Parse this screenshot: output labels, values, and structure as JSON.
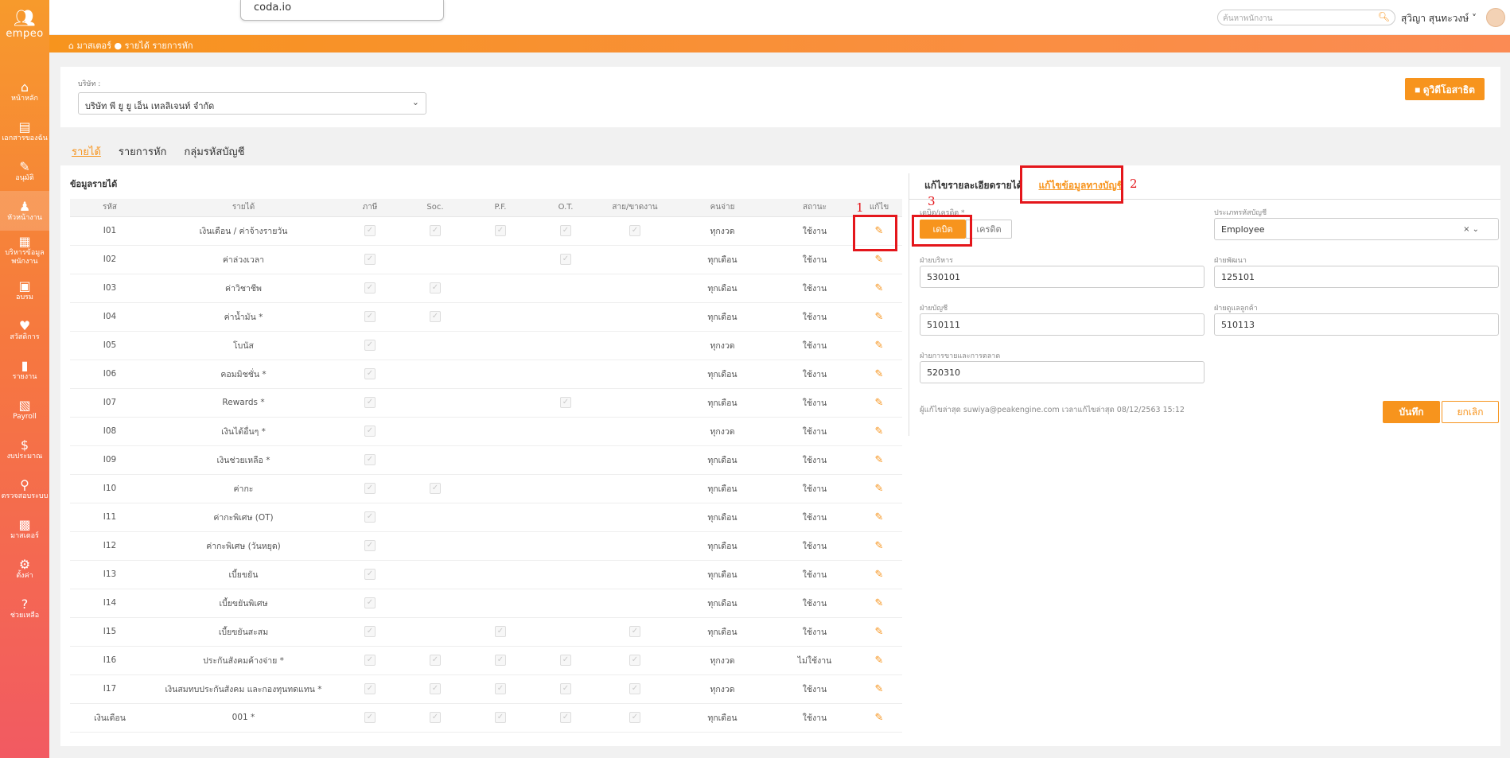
{
  "app": {
    "logo_text": "empeo"
  },
  "sidebar": {
    "items": [
      {
        "label": "หน้าหลัก",
        "icon": "home-icon",
        "glyph": "⌂"
      },
      {
        "label": "เอกสารของฉัน",
        "icon": "document-icon",
        "glyph": "▤"
      },
      {
        "label": "อนุมัติ",
        "icon": "approve-icon",
        "glyph": "✎"
      },
      {
        "label": "หัวหน้างาน",
        "icon": "supervisor-icon",
        "glyph": "♟"
      },
      {
        "label": "บริหารข้อมูลพนักงาน",
        "icon": "employee-icon",
        "glyph": "▦"
      },
      {
        "label": "อบรม",
        "icon": "training-icon",
        "glyph": "▣"
      },
      {
        "label": "สวัสดิการ",
        "icon": "welfare-icon",
        "glyph": "♥"
      },
      {
        "label": "รายงาน",
        "icon": "report-icon",
        "glyph": "▮"
      },
      {
        "label": "Payroll",
        "icon": "payroll-icon",
        "glyph": "▧"
      },
      {
        "label": "งบประมาณ",
        "icon": "budget-icon",
        "glyph": "$"
      },
      {
        "label": "ตรวจสอบระบบ",
        "icon": "audit-icon",
        "glyph": "⚲"
      },
      {
        "label": "มาสเตอร์",
        "icon": "master-icon",
        "glyph": "▩"
      },
      {
        "label": "ตั้งค่า",
        "icon": "settings-icon",
        "glyph": "⚙"
      },
      {
        "label": "ช่วยเหลือ",
        "icon": "help-icon",
        "glyph": "?"
      }
    ]
  },
  "topbar": {
    "popup_text": "coda.io",
    "search_placeholder": "ค้นหาพนักงาน",
    "user_name": "สุวิญา สุนทะวงษ์"
  },
  "breadcrumb": "มาสเตอร์ ● รายได้ รายการหัก",
  "company": {
    "label": "บริษัท :",
    "value": "บริษัท พี ยู ยู เอ็น เทลลิเจนท์ จำกัด",
    "video_button": "ดูวิดีโอสาธิต"
  },
  "tabs": [
    "รายได้",
    "รายการหัก",
    "กลุ่มรหัสบัญชี"
  ],
  "income": {
    "title": "ข้อมูลรายได้",
    "columns": [
      "รหัส",
      "รายได้",
      "ภาษี",
      "Soc.",
      "P.F.",
      "O.T.",
      "สาย/ขาดงาน",
      "คนจ่าย",
      "สถานะ",
      "แก้ไข"
    ],
    "rows": [
      {
        "code": "I01",
        "name": "เงินเดือน / ค่าจ้างรายวัน",
        "tax": true,
        "soc": true,
        "pf": true,
        "ot": true,
        "late": true,
        "pay": "ทุกงวด",
        "status": "ใช้งาน"
      },
      {
        "code": "I02",
        "name": "ค่าล่วงเวลา",
        "tax": true,
        "soc": false,
        "pf": false,
        "ot": true,
        "late": false,
        "pay": "ทุกเดือน",
        "status": "ใช้งาน"
      },
      {
        "code": "I03",
        "name": "ค่าวิชาชีพ",
        "tax": true,
        "soc": true,
        "pf": false,
        "ot": false,
        "late": false,
        "pay": "ทุกเดือน",
        "status": "ใช้งาน"
      },
      {
        "code": "I04",
        "name": "ค่าน้ำมัน *",
        "tax": true,
        "soc": true,
        "pf": false,
        "ot": false,
        "late": false,
        "pay": "ทุกเดือน",
        "status": "ใช้งาน"
      },
      {
        "code": "I05",
        "name": "โบนัส",
        "tax": true,
        "soc": false,
        "pf": false,
        "ot": false,
        "late": false,
        "pay": "ทุกงวด",
        "status": "ใช้งาน"
      },
      {
        "code": "I06",
        "name": "คอมมิชชั่น *",
        "tax": true,
        "soc": false,
        "pf": false,
        "ot": false,
        "late": false,
        "pay": "ทุกเดือน",
        "status": "ใช้งาน"
      },
      {
        "code": "I07",
        "name": "Rewards *",
        "tax": true,
        "soc": false,
        "pf": false,
        "ot": true,
        "late": false,
        "pay": "ทุกเดือน",
        "status": "ใช้งาน"
      },
      {
        "code": "I08",
        "name": "เงินได้อื่นๆ *",
        "tax": true,
        "soc": false,
        "pf": false,
        "ot": false,
        "late": false,
        "pay": "ทุกงวด",
        "status": "ใช้งาน"
      },
      {
        "code": "I09",
        "name": "เงินช่วยเหลือ *",
        "tax": true,
        "soc": false,
        "pf": false,
        "ot": false,
        "late": false,
        "pay": "ทุกเดือน",
        "status": "ใช้งาน"
      },
      {
        "code": "I10",
        "name": "ค่ากะ",
        "tax": true,
        "soc": true,
        "pf": false,
        "ot": false,
        "late": false,
        "pay": "ทุกเดือน",
        "status": "ใช้งาน"
      },
      {
        "code": "I11",
        "name": "ค่ากะพิเศษ (OT)",
        "tax": true,
        "soc": false,
        "pf": false,
        "ot": false,
        "late": false,
        "pay": "ทุกเดือน",
        "status": "ใช้งาน"
      },
      {
        "code": "I12",
        "name": "ค่ากะพิเศษ (วันหยุด)",
        "tax": true,
        "soc": false,
        "pf": false,
        "ot": false,
        "late": false,
        "pay": "ทุกเดือน",
        "status": "ใช้งาน"
      },
      {
        "code": "I13",
        "name": "เบี้ยขยัน",
        "tax": true,
        "soc": false,
        "pf": false,
        "ot": false,
        "late": false,
        "pay": "ทุกเดือน",
        "status": "ใช้งาน"
      },
      {
        "code": "I14",
        "name": "เบี้ยขยันพิเศษ",
        "tax": true,
        "soc": false,
        "pf": false,
        "ot": false,
        "late": false,
        "pay": "ทุกเดือน",
        "status": "ใช้งาน"
      },
      {
        "code": "I15",
        "name": "เบี้ยขยันสะสม",
        "tax": true,
        "soc": false,
        "pf": true,
        "ot": false,
        "late": true,
        "pay": "ทุกเดือน",
        "status": "ใช้งาน"
      },
      {
        "code": "I16",
        "name": "ประกันสังคมค้างจ่าย *",
        "tax": true,
        "soc": true,
        "pf": true,
        "ot": true,
        "late": true,
        "pay": "ทุกงวด",
        "status": "ไม่ใช้งาน"
      },
      {
        "code": "I17",
        "name": "เงินสมทบประกันสังคม และกองทุนทดแทน *",
        "tax": true,
        "soc": true,
        "pf": true,
        "ot": true,
        "late": true,
        "pay": "ทุกงวด",
        "status": "ใช้งาน"
      },
      {
        "code": "เงินเดือน",
        "name": "001 *",
        "tax": true,
        "soc": true,
        "pf": true,
        "ot": true,
        "late": true,
        "pay": "ทุกเดือน",
        "status": "ใช้งาน"
      }
    ]
  },
  "detail": {
    "tab_details": "แก้ไขรายละเอียดรายได้",
    "tab_accounting": "แก้ไขข้อมูลทางบัญชี",
    "debit_credit_label": "เดบิต/เครดิต *",
    "debit": "เดบิต",
    "credit": "เครดิต",
    "account_type_label": "ประเภทรหัสบัญชี",
    "account_type_value": "Employee",
    "admin_label": "ฝ่ายบริหาร",
    "admin_value": "530101",
    "dev_label": "ฝ่ายพัฒนา",
    "dev_value": "125101",
    "accounting_label": "ฝ่ายบัญชี",
    "accounting_value": "510111",
    "cs_label": "ฝ่ายดูแลลูกค้า",
    "cs_value": "510113",
    "marketing_label": "ฝ่ายการขายและการตลาด",
    "marketing_value": "520310",
    "footnote": "ผู้แก้ไขล่าสุด suwiya@peakengine.com เวลาแก้ไขล่าสุด 08/12/2563 15:12",
    "save": "บันทึก",
    "cancel": "ยกเลิก"
  },
  "annotations": [
    "1",
    "2",
    "3"
  ],
  "colors": {
    "accent": "#f7941d",
    "annotation": "#e4161b"
  }
}
